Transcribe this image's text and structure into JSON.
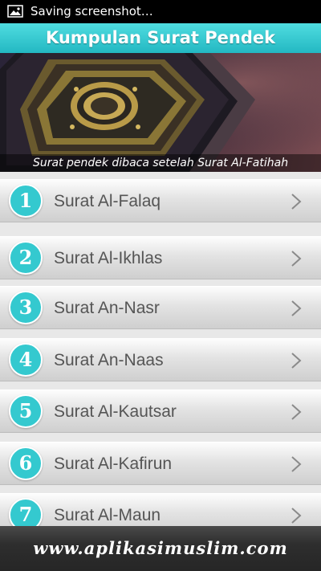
{
  "status_bar": {
    "notification_icon": "image-icon",
    "text": "Saving screenshot…"
  },
  "title_bar": {
    "title": "Kumpulan Surat Pendek"
  },
  "banner": {
    "caption": "Surat pendek dibaca setelah Surat Al-Fatihah"
  },
  "list": {
    "items": [
      {
        "number": "1",
        "label": "Surat Al-Falaq"
      },
      {
        "number": "2",
        "label": "Surat Al-Ikhlas"
      },
      {
        "number": "3",
        "label": "Surat An-Nasr"
      },
      {
        "number": "4",
        "label": "Surat An-Naas"
      },
      {
        "number": "5",
        "label": "Surat Al-Kautsar"
      },
      {
        "number": "6",
        "label": "Surat Al-Kafirun"
      },
      {
        "number": "7",
        "label": "Surat Al-Maun"
      }
    ],
    "chevron_icon": "chevron-right-icon"
  },
  "footer": {
    "text": "www.aplikasimuslim.com"
  },
  "colors": {
    "accent": "#34c9cf",
    "title_bar": "#2fc4cc",
    "footer": "#2e2e2e"
  }
}
